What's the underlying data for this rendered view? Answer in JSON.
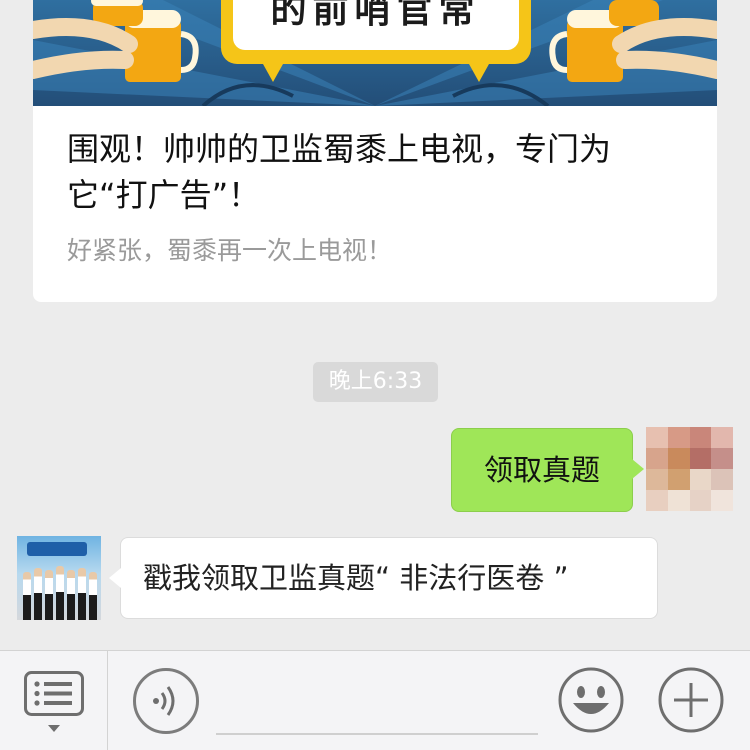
{
  "article": {
    "banner_text": "的前哨官常",
    "title": "围观！帅帅的卫监蜀黍上电视，专门为它“打广告”！",
    "description": "好紧张，蜀黍再一次上电视！"
  },
  "timestamp": "晚上6:33",
  "messages": {
    "outgoing": {
      "text": "领取真题"
    },
    "incoming": {
      "text": "戳我领取卫监真题“ 非法行医卷 ”"
    }
  },
  "toolbar": {
    "menu_icon": "list-menu-icon",
    "voice_icon": "voice-icon",
    "emoji_icon": "smiley-icon",
    "plus_icon": "plus-icon",
    "input_value": ""
  },
  "colors": {
    "chat_background": "#ececec",
    "outgoing_bubble": "#9fe658",
    "incoming_bubble": "#ffffff",
    "banner_blue": "#2f6fa0",
    "timestamp_bg": "#d9d9d9"
  }
}
